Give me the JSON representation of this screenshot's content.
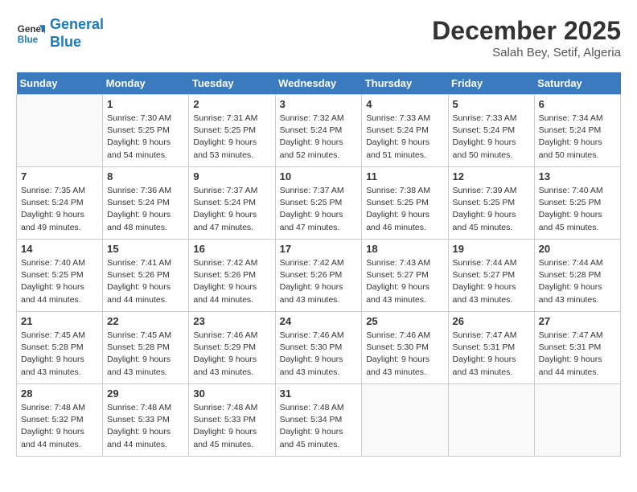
{
  "header": {
    "logo_line1": "General",
    "logo_line2": "Blue",
    "month": "December 2025",
    "location": "Salah Bey, Setif, Algeria"
  },
  "days_of_week": [
    "Sunday",
    "Monday",
    "Tuesday",
    "Wednesday",
    "Thursday",
    "Friday",
    "Saturday"
  ],
  "weeks": [
    [
      {
        "day": "",
        "info": ""
      },
      {
        "day": "1",
        "info": "Sunrise: 7:30 AM\nSunset: 5:25 PM\nDaylight: 9 hours\nand 54 minutes."
      },
      {
        "day": "2",
        "info": "Sunrise: 7:31 AM\nSunset: 5:25 PM\nDaylight: 9 hours\nand 53 minutes."
      },
      {
        "day": "3",
        "info": "Sunrise: 7:32 AM\nSunset: 5:24 PM\nDaylight: 9 hours\nand 52 minutes."
      },
      {
        "day": "4",
        "info": "Sunrise: 7:33 AM\nSunset: 5:24 PM\nDaylight: 9 hours\nand 51 minutes."
      },
      {
        "day": "5",
        "info": "Sunrise: 7:33 AM\nSunset: 5:24 PM\nDaylight: 9 hours\nand 50 minutes."
      },
      {
        "day": "6",
        "info": "Sunrise: 7:34 AM\nSunset: 5:24 PM\nDaylight: 9 hours\nand 50 minutes."
      }
    ],
    [
      {
        "day": "7",
        "info": "Sunrise: 7:35 AM\nSunset: 5:24 PM\nDaylight: 9 hours\nand 49 minutes."
      },
      {
        "day": "8",
        "info": "Sunrise: 7:36 AM\nSunset: 5:24 PM\nDaylight: 9 hours\nand 48 minutes."
      },
      {
        "day": "9",
        "info": "Sunrise: 7:37 AM\nSunset: 5:24 PM\nDaylight: 9 hours\nand 47 minutes."
      },
      {
        "day": "10",
        "info": "Sunrise: 7:37 AM\nSunset: 5:25 PM\nDaylight: 9 hours\nand 47 minutes."
      },
      {
        "day": "11",
        "info": "Sunrise: 7:38 AM\nSunset: 5:25 PM\nDaylight: 9 hours\nand 46 minutes."
      },
      {
        "day": "12",
        "info": "Sunrise: 7:39 AM\nSunset: 5:25 PM\nDaylight: 9 hours\nand 45 minutes."
      },
      {
        "day": "13",
        "info": "Sunrise: 7:40 AM\nSunset: 5:25 PM\nDaylight: 9 hours\nand 45 minutes."
      }
    ],
    [
      {
        "day": "14",
        "info": "Sunrise: 7:40 AM\nSunset: 5:25 PM\nDaylight: 9 hours\nand 44 minutes."
      },
      {
        "day": "15",
        "info": "Sunrise: 7:41 AM\nSunset: 5:26 PM\nDaylight: 9 hours\nand 44 minutes."
      },
      {
        "day": "16",
        "info": "Sunrise: 7:42 AM\nSunset: 5:26 PM\nDaylight: 9 hours\nand 44 minutes."
      },
      {
        "day": "17",
        "info": "Sunrise: 7:42 AM\nSunset: 5:26 PM\nDaylight: 9 hours\nand 43 minutes."
      },
      {
        "day": "18",
        "info": "Sunrise: 7:43 AM\nSunset: 5:27 PM\nDaylight: 9 hours\nand 43 minutes."
      },
      {
        "day": "19",
        "info": "Sunrise: 7:44 AM\nSunset: 5:27 PM\nDaylight: 9 hours\nand 43 minutes."
      },
      {
        "day": "20",
        "info": "Sunrise: 7:44 AM\nSunset: 5:28 PM\nDaylight: 9 hours\nand 43 minutes."
      }
    ],
    [
      {
        "day": "21",
        "info": "Sunrise: 7:45 AM\nSunset: 5:28 PM\nDaylight: 9 hours\nand 43 minutes."
      },
      {
        "day": "22",
        "info": "Sunrise: 7:45 AM\nSunset: 5:28 PM\nDaylight: 9 hours\nand 43 minutes."
      },
      {
        "day": "23",
        "info": "Sunrise: 7:46 AM\nSunset: 5:29 PM\nDaylight: 9 hours\nand 43 minutes."
      },
      {
        "day": "24",
        "info": "Sunrise: 7:46 AM\nSunset: 5:30 PM\nDaylight: 9 hours\nand 43 minutes."
      },
      {
        "day": "25",
        "info": "Sunrise: 7:46 AM\nSunset: 5:30 PM\nDaylight: 9 hours\nand 43 minutes."
      },
      {
        "day": "26",
        "info": "Sunrise: 7:47 AM\nSunset: 5:31 PM\nDaylight: 9 hours\nand 43 minutes."
      },
      {
        "day": "27",
        "info": "Sunrise: 7:47 AM\nSunset: 5:31 PM\nDaylight: 9 hours\nand 44 minutes."
      }
    ],
    [
      {
        "day": "28",
        "info": "Sunrise: 7:48 AM\nSunset: 5:32 PM\nDaylight: 9 hours\nand 44 minutes."
      },
      {
        "day": "29",
        "info": "Sunrise: 7:48 AM\nSunset: 5:33 PM\nDaylight: 9 hours\nand 44 minutes."
      },
      {
        "day": "30",
        "info": "Sunrise: 7:48 AM\nSunset: 5:33 PM\nDaylight: 9 hours\nand 45 minutes."
      },
      {
        "day": "31",
        "info": "Sunrise: 7:48 AM\nSunset: 5:34 PM\nDaylight: 9 hours\nand 45 minutes."
      },
      {
        "day": "",
        "info": ""
      },
      {
        "day": "",
        "info": ""
      },
      {
        "day": "",
        "info": ""
      }
    ]
  ]
}
